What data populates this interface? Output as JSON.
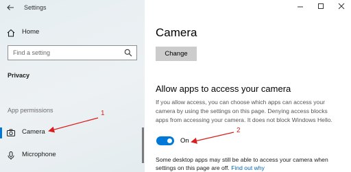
{
  "window": {
    "app_title": "Settings",
    "controls": [
      "minimize-icon",
      "maximize-icon",
      "close-icon"
    ]
  },
  "sidebar": {
    "home_label": "Home",
    "search_placeholder": "Find a setting",
    "section_header": "Privacy",
    "group_label": "App permissions",
    "items": [
      {
        "label": "Camera",
        "icon": "camera-icon",
        "selected": true
      },
      {
        "label": "Microphone",
        "icon": "microphone-icon",
        "selected": false
      }
    ]
  },
  "main": {
    "title": "Camera",
    "change_button": "Change",
    "subheading": "Allow apps to access your camera",
    "description": "If you allow access, you can choose which apps can access your camera by using the settings on this page. Denying access blocks apps from accessing your camera. It does not block Windows Hello.",
    "toggle_state": "On",
    "toggle_on": true,
    "footer_text": "Some desktop apps may still be able to access your camera when settings on this page are off.",
    "footer_link": "Find out why"
  },
  "annotations": [
    {
      "number": "1"
    },
    {
      "number": "2"
    }
  ],
  "colors": {
    "accent": "#0078d7",
    "annotation": "#d81e1e",
    "link": "#0063b1"
  }
}
